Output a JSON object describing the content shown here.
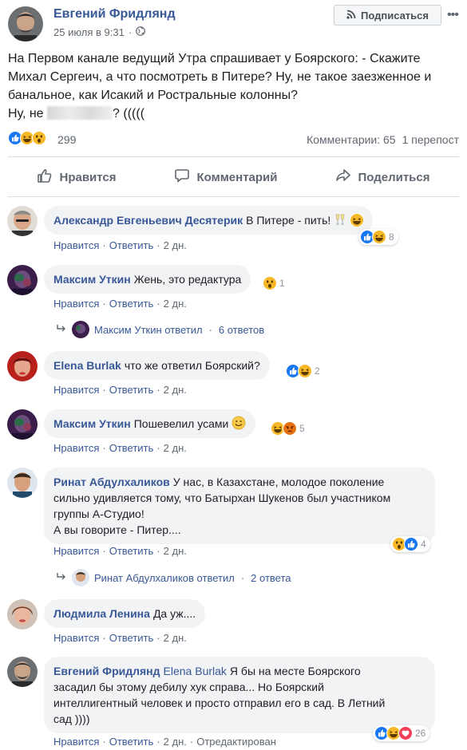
{
  "post": {
    "author": "Евгений Фридлянд",
    "date": "25 июля в 9:31",
    "subscribe_label": "Подписаться",
    "text_line1": "На Первом канале ведущий Утра спрашивает у Боярского: - Скажите",
    "text_line2": "Михал Сергеич, а что посмотреть в Питере? Ну, не такое заезженное и",
    "text_line3": "банальное, как Исакий и Ростральные колонны?",
    "text_line4_start": "Ну, не ",
    "text_line4_end": "? (((((",
    "reaction_count": "299",
    "comments_label": "Комментарии: 65",
    "shares_label": "1 перепост"
  },
  "actions": {
    "like": "Нравится",
    "comment": "Комментарий",
    "share": "Поделиться"
  },
  "comment_links": {
    "like": "Нравится",
    "reply": "Ответить",
    "edited": "Отредактирован"
  },
  "comments": [
    {
      "author": "Александр Евгеньевич Десятерик",
      "text": "В Питере - пить!",
      "time": "2 дн.",
      "reactions": "8"
    },
    {
      "author": "Максим Уткин",
      "text": "Жень, это редактура",
      "time": "2 дн.",
      "reactions": "1",
      "reply_author": "Максим Уткин ответил",
      "reply_count": "6 ответов"
    },
    {
      "author": "Elena Burlak",
      "text": "что же ответил Боярский?",
      "time": "2 дн.",
      "reactions": "2"
    },
    {
      "author": "Максим Уткин",
      "text": "Пошевелил усами",
      "time": "2 дн.",
      "reactions": "5"
    },
    {
      "author": "Ринат Абдулхаликов",
      "text_line1": "У нас, в Казахстане, молодое поколение",
      "text_line2": "сильно удивляется тому, что Батырхан Шукенов был участником",
      "text_line3": "группы А-Студио!",
      "text_line4": "А вы говорите - Питер....",
      "time": "2 дн.",
      "reactions": "4",
      "reply_author": "Ринат Абдулхаликов ответил",
      "reply_count": "2 ответа"
    },
    {
      "author": "Людмила Ленина",
      "text": "Да уж....",
      "time": "2 дн."
    },
    {
      "author": "Евгений Фридлянд",
      "mention": "Elena Burlak",
      "text_line1": "Я бы на месте Боярского",
      "text_line2": "засадил бы этому дебилу хук справа... Но Боярский",
      "text_line3": "интеллигентный человек и просто отправил его в сад. В Летний",
      "text_line4": "сад ))))",
      "time": "2 дн.",
      "reactions": "26"
    }
  ],
  "colors": {
    "link": "#385898",
    "meta": "#606770",
    "bubble": "#f2f3f5",
    "like_blue": "#1877f2",
    "haha_yellow": "#f7b928",
    "love_red": "#f33e58"
  }
}
